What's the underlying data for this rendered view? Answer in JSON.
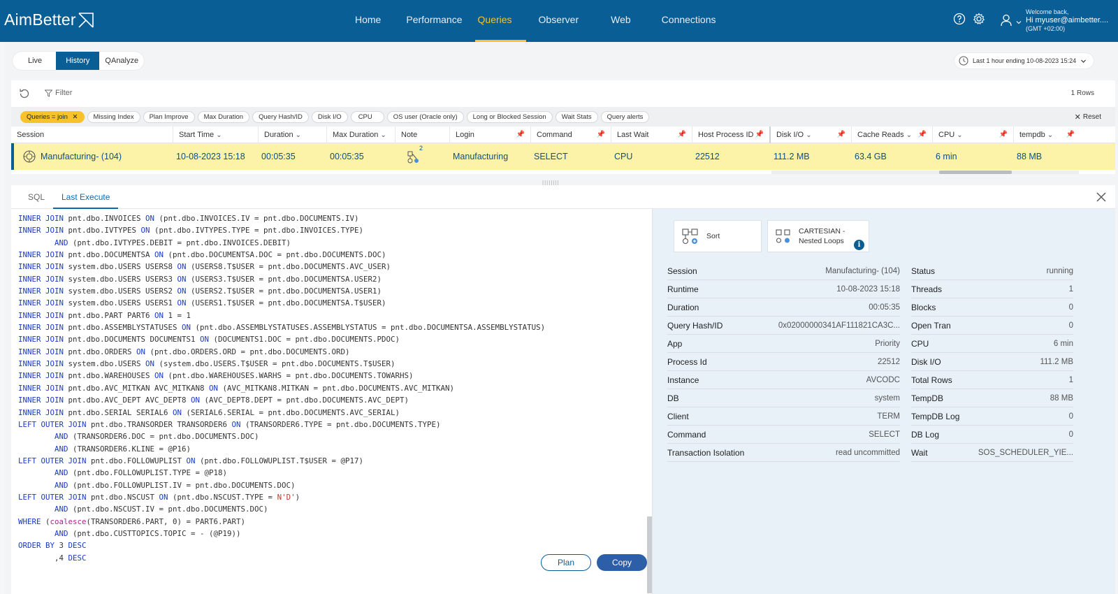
{
  "app": {
    "logo": "AimBetter"
  },
  "nav": {
    "items": [
      {
        "label": "Home"
      },
      {
        "label": "Performance"
      },
      {
        "label": "Queries"
      },
      {
        "label": "Observer"
      },
      {
        "label": "Web"
      },
      {
        "label": "Connections"
      }
    ],
    "active": "Queries"
  },
  "user": {
    "welcome": "Welcome back,",
    "name": "Hi myuser@aimbetter....",
    "tz": "(GMT +02:00)"
  },
  "modes": {
    "items": [
      {
        "label": "Live"
      },
      {
        "label": "History"
      },
      {
        "label": "QAnalyze"
      }
    ],
    "active": "History"
  },
  "time_range": {
    "label": "Last 1 hour ending  10-08-2023 15:24"
  },
  "filter": {
    "label": "Filter",
    "rows": "1 Rows"
  },
  "chips": {
    "items": [
      {
        "label": "Queries = join"
      },
      {
        "label": "Missing Index"
      },
      {
        "label": "Plan Improve"
      },
      {
        "label": "Max Duration"
      },
      {
        "label": "Query Hash/ID"
      },
      {
        "label": "Disk I/O"
      },
      {
        "label": "CPU"
      },
      {
        "label": "OS user (Oracle only)"
      },
      {
        "label": "Long or Blocked Session"
      },
      {
        "label": "Wait Stats"
      },
      {
        "label": "Query alerts"
      }
    ],
    "reset": "Reset"
  },
  "table": {
    "columns": [
      "Session",
      "Start Time",
      "Duration",
      "Max Duration",
      "Note",
      "Login",
      "Command",
      "Last Wait",
      "Host Process ID",
      "Disk I/O",
      "Cache Reads",
      "CPU",
      "tempdb"
    ],
    "row": {
      "session": "Manufacturing- (104)",
      "start_time": "10-08-2023 15:18",
      "duration": "00:05:35",
      "max_duration": "00:05:35",
      "note_count": "2",
      "login": "Manufacturing",
      "command": "SELECT",
      "last_wait": "CPU",
      "host_pid": "22512",
      "disk_io": "111.2 MB",
      "cache_reads": "63.4 GB",
      "cpu": "6 min",
      "tempdb": "88 MB"
    }
  },
  "panel": {
    "tabs": [
      {
        "label": "SQL"
      },
      {
        "label": "Last Execute"
      }
    ],
    "active_tab": "Last Execute",
    "plan_label": "Plan",
    "copy_label": "Copy",
    "sql_lines": [
      [
        {
          "k": 1,
          "t": "INNER JOIN"
        },
        {
          "t": " pnt.dbo.INVOICES "
        },
        {
          "k": 1,
          "t": "ON"
        },
        {
          "t": " (pnt.dbo.INVOICES.IV = pnt.dbo.DOCUMENTS.IV)"
        }
      ],
      [
        {
          "k": 1,
          "t": "INNER JOIN"
        },
        {
          "t": " pnt.dbo.IVTYPES "
        },
        {
          "k": 1,
          "t": "ON"
        },
        {
          "t": " (pnt.dbo.IVTYPES.TYPE = pnt.dbo.INVOICES.TYPE)"
        }
      ],
      [
        {
          "t": "        "
        },
        {
          "k": 1,
          "t": "AND"
        },
        {
          "t": " (pnt.dbo.IVTYPES.DEBIT = pnt.dbo.INVOICES.DEBIT)"
        }
      ],
      [
        {
          "k": 1,
          "t": "INNER JOIN"
        },
        {
          "t": " pnt.dbo.DOCUMENTSA "
        },
        {
          "k": 1,
          "t": "ON"
        },
        {
          "t": " (pnt.dbo.DOCUMENTSA.DOC = pnt.dbo.DOCUMENTS.DOC)"
        }
      ],
      [
        {
          "k": 1,
          "t": "INNER JOIN"
        },
        {
          "t": " system.dbo.USERS USERS8 "
        },
        {
          "k": 1,
          "t": "ON"
        },
        {
          "t": " (USERS8.T$USER = pnt.dbo.DOCUMENTS.AVC_USER)"
        }
      ],
      [
        {
          "k": 1,
          "t": "INNER JOIN"
        },
        {
          "t": " system.dbo.USERS USERS3 "
        },
        {
          "k": 1,
          "t": "ON"
        },
        {
          "t": " (USERS3.T$USER = pnt.dbo.DOCUMENTSA.USER2)"
        }
      ],
      [
        {
          "k": 1,
          "t": "INNER JOIN"
        },
        {
          "t": " system.dbo.USERS USERS2 "
        },
        {
          "k": 1,
          "t": "ON"
        },
        {
          "t": " (USERS2.T$USER = pnt.dbo.DOCUMENTSA.USER1)"
        }
      ],
      [
        {
          "k": 1,
          "t": "INNER JOIN"
        },
        {
          "t": " system.dbo.USERS USERS1 "
        },
        {
          "k": 1,
          "t": "ON"
        },
        {
          "t": " (USERS1.T$USER = pnt.dbo.DOCUMENTSA.T$USER)"
        }
      ],
      [
        {
          "k": 1,
          "t": "INNER JOIN"
        },
        {
          "t": " pnt.dbo.PART PART6 "
        },
        {
          "k": 1,
          "t": "ON"
        },
        {
          "t": " 1 = 1"
        }
      ],
      [
        {
          "k": 1,
          "t": "INNER JOIN"
        },
        {
          "t": " pnt.dbo.ASSEMBLYSTATUSES "
        },
        {
          "k": 1,
          "t": "ON"
        },
        {
          "t": " (pnt.dbo.ASSEMBLYSTATUSES.ASSEMBLYSTATUS = pnt.dbo.DOCUMENTSA.ASSEMBLYSTATUS)"
        }
      ],
      [
        {
          "k": 1,
          "t": "INNER JOIN"
        },
        {
          "t": " pnt.dbo.DOCUMENTS DOCUMENTS1 "
        },
        {
          "k": 1,
          "t": "ON"
        },
        {
          "t": " (DOCUMENTS1.DOC = pnt.dbo.DOCUMENTS.PDOC)"
        }
      ],
      [
        {
          "k": 1,
          "t": "INNER JOIN"
        },
        {
          "t": " pnt.dbo.ORDERS "
        },
        {
          "k": 1,
          "t": "ON"
        },
        {
          "t": " (pnt.dbo.ORDERS.ORD = pnt.dbo.DOCUMENTS.ORD)"
        }
      ],
      [
        {
          "k": 1,
          "t": "INNER JOIN"
        },
        {
          "t": " system.dbo.USERS "
        },
        {
          "k": 1,
          "t": "ON"
        },
        {
          "t": " (system.dbo.USERS.T$USER = pnt.dbo.DOCUMENTS.T$USER)"
        }
      ],
      [
        {
          "k": 1,
          "t": "INNER JOIN"
        },
        {
          "t": " pnt.dbo.WAREHOUSES "
        },
        {
          "k": 1,
          "t": "ON"
        },
        {
          "t": " (pnt.dbo.WAREHOUSES.WARHS = pnt.dbo.DOCUMENTS.TOWARHS)"
        }
      ],
      [
        {
          "k": 1,
          "t": "INNER JOIN"
        },
        {
          "t": " pnt.dbo.AVC_MITKAN AVC_MITKAN8 "
        },
        {
          "k": 1,
          "t": "ON"
        },
        {
          "t": " (AVC_MITKAN8.MITKAN = pnt.dbo.DOCUMENTS.AVC_MITKAN)"
        }
      ],
      [
        {
          "k": 1,
          "t": "INNER JOIN"
        },
        {
          "t": " pnt.dbo.AVC_DEPT AVC_DEPT8 "
        },
        {
          "k": 1,
          "t": "ON"
        },
        {
          "t": " (AVC_DEPT8.DEPT = pnt.dbo.DOCUMENTS.AVC_DEPT)"
        }
      ],
      [
        {
          "k": 1,
          "t": "INNER JOIN"
        },
        {
          "t": " pnt.dbo.SERIAL SERIAL6 "
        },
        {
          "k": 1,
          "t": "ON"
        },
        {
          "t": " (SERIAL6.SERIAL = pnt.dbo.DOCUMENTS.AVC_SERIAL)"
        }
      ],
      [
        {
          "k": 1,
          "t": "LEFT OUTER JOIN"
        },
        {
          "t": " pnt.dbo.TRANSORDER TRANSORDER6 "
        },
        {
          "k": 1,
          "t": "ON"
        },
        {
          "t": " (TRANSORDER6.TYPE = pnt.dbo.DOCUMENTS.TYPE)"
        }
      ],
      [
        {
          "t": "        "
        },
        {
          "k": 1,
          "t": "AND"
        },
        {
          "t": " (TRANSORDER6.DOC = pnt.dbo.DOCUMENTS.DOC)"
        }
      ],
      [
        {
          "t": "        "
        },
        {
          "k": 1,
          "t": "AND"
        },
        {
          "t": " (TRANSORDER6.KLINE = @P16)"
        }
      ],
      [
        {
          "k": 1,
          "t": "LEFT OUTER JOIN"
        },
        {
          "t": " pnt.dbo.FOLLOWUPLIST "
        },
        {
          "k": 1,
          "t": "ON"
        },
        {
          "t": " (pnt.dbo.FOLLOWUPLIST.T$USER = @P17)"
        }
      ],
      [
        {
          "t": "        "
        },
        {
          "k": 1,
          "t": "AND"
        },
        {
          "t": " (pnt.dbo.FOLLOWUPLIST.TYPE = @P18)"
        }
      ],
      [
        {
          "t": "        "
        },
        {
          "k": 1,
          "t": "AND"
        },
        {
          "t": " (pnt.dbo.FOLLOWUPLIST.IV = pnt.dbo.DOCUMENTS.DOC)"
        }
      ],
      [
        {
          "k": 1,
          "t": "LEFT OUTER JOIN"
        },
        {
          "t": " pnt.dbo.NSCUST "
        },
        {
          "k": 1,
          "t": "ON"
        },
        {
          "t": " (pnt.dbo.NSCUST.TYPE = "
        },
        {
          "s": 1,
          "t": "N'D'"
        },
        {
          "t": ")"
        }
      ],
      [
        {
          "t": "        "
        },
        {
          "k": 1,
          "t": "AND"
        },
        {
          "t": " (pnt.dbo.NSCUST.IV = pnt.dbo.DOCUMENTS.DOC)"
        }
      ],
      [
        {
          "k": 1,
          "t": "WHERE"
        },
        {
          "t": " ("
        },
        {
          "f": 1,
          "t": "coalesce"
        },
        {
          "t": "(TRANSORDER6.PART, 0) = PART6.PART)"
        }
      ],
      [
        {
          "t": "        "
        },
        {
          "k": 1,
          "t": "AND"
        },
        {
          "t": " (pnt.dbo.CUSTTOPICS.TOPIC = - (@P19))"
        }
      ],
      [
        {
          "k": 1,
          "t": "ORDER BY"
        },
        {
          "t": " 3 "
        },
        {
          "k": 1,
          "t": "DESC"
        }
      ],
      [
        {
          "t": "        ,4 "
        },
        {
          "k": 1,
          "t": "DESC"
        }
      ]
    ]
  },
  "details": {
    "ops": [
      {
        "label": "Sort"
      },
      {
        "label": "CARTESIAN -",
        "label2": "Nested Loops"
      }
    ],
    "left": [
      {
        "k": "Session",
        "v": "Manufacturing- (104)"
      },
      {
        "k": "Runtime",
        "v": "10-08-2023 15:18"
      },
      {
        "k": "Duration",
        "v": "00:05:35"
      },
      {
        "k": "Query Hash/ID",
        "v": "0x02000000341AF111821CA3C..."
      },
      {
        "k": "App",
        "v": "Priority"
      },
      {
        "k": "Process Id",
        "v": "22512"
      },
      {
        "k": "Instance",
        "v": "AVCODC"
      },
      {
        "k": "DB",
        "v": "system"
      },
      {
        "k": "Client",
        "v": "TERM"
      },
      {
        "k": "Command",
        "v": "SELECT"
      },
      {
        "k": "Transaction Isolation",
        "v": "read uncommitted"
      }
    ],
    "right": [
      {
        "k": "Status",
        "v": "running"
      },
      {
        "k": "Threads",
        "v": "1"
      },
      {
        "k": "Blocks",
        "v": "0"
      },
      {
        "k": "Open Tran",
        "v": "0"
      },
      {
        "k": "CPU",
        "v": "6 min"
      },
      {
        "k": "Disk I/O",
        "v": "111.2 MB"
      },
      {
        "k": "Total Rows",
        "v": "1"
      },
      {
        "k": "TempDB",
        "v": "88 MB"
      },
      {
        "k": "TempDB Log",
        "v": "0"
      },
      {
        "k": "DB Log",
        "v": "0"
      },
      {
        "k": "Wait",
        "v": "SOS_SCHEDULER_YIE..."
      }
    ]
  }
}
